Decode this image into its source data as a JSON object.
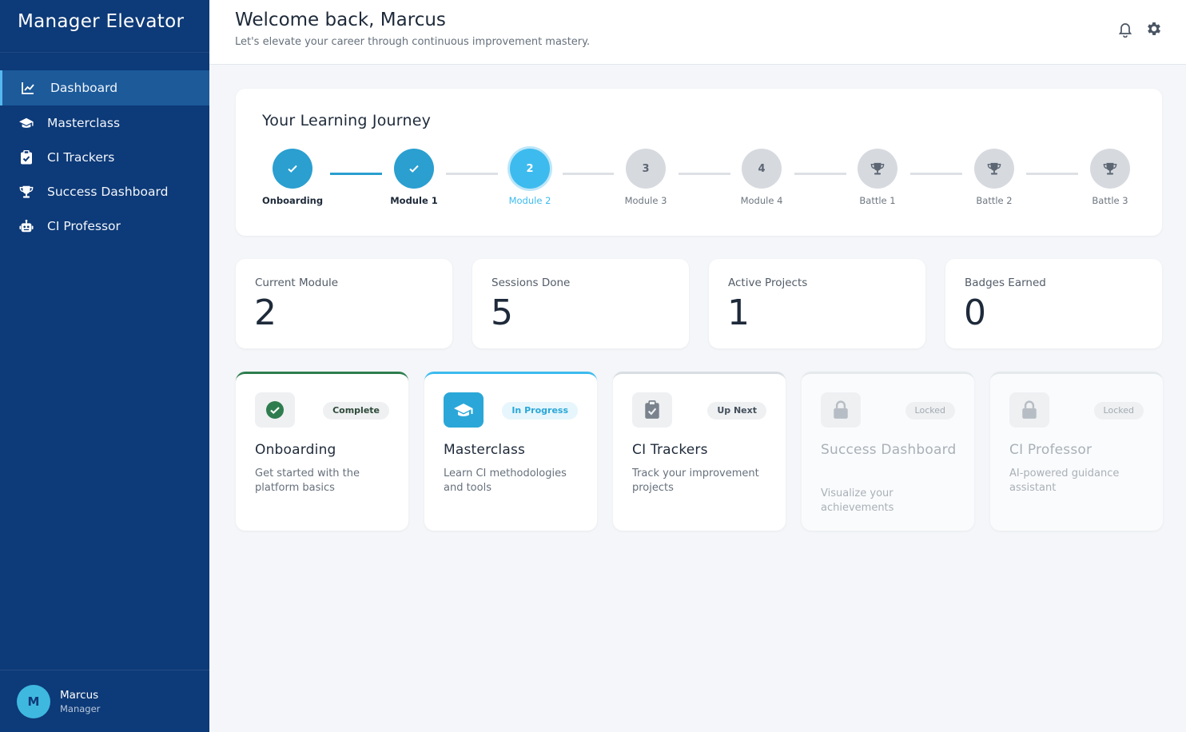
{
  "app": {
    "title": "Manager Elevator"
  },
  "sidebar": {
    "items": [
      {
        "label": "Dashboard",
        "icon": "chart-line-icon"
      },
      {
        "label": "Masterclass",
        "icon": "graduation-cap-icon"
      },
      {
        "label": "CI Trackers",
        "icon": "clipboard-check-icon"
      },
      {
        "label": "Success Dashboard",
        "icon": "trophy-icon"
      },
      {
        "label": "CI Professor",
        "icon": "robot-icon"
      }
    ],
    "active": "Dashboard"
  },
  "user": {
    "initial": "M",
    "name": "Marcus",
    "role": "Manager"
  },
  "header": {
    "welcome": "Welcome back, Marcus",
    "subtitle": "Let's elevate your career through continuous improvement mastery.",
    "icons": [
      "bell-icon",
      "gear-icon"
    ]
  },
  "journey": {
    "title": "Your Learning Journey",
    "steps": [
      {
        "label": "Onboarding",
        "marker": "",
        "state": "done"
      },
      {
        "label": "Module 1",
        "marker": "",
        "state": "done"
      },
      {
        "label": "Module 2",
        "marker": "2",
        "state": "current"
      },
      {
        "label": "Module 3",
        "marker": "3",
        "state": "todo"
      },
      {
        "label": "Module 4",
        "marker": "4",
        "state": "todo"
      },
      {
        "label": "Battle 1",
        "marker": "",
        "state": "todo"
      },
      {
        "label": "Battle 2",
        "marker": "",
        "state": "todo"
      },
      {
        "label": "Battle 3",
        "marker": "",
        "state": "todo"
      }
    ]
  },
  "stats": [
    {
      "label": "Current Module",
      "value": "2"
    },
    {
      "label": "Sessions Done",
      "value": "5"
    },
    {
      "label": "Active Projects",
      "value": "1"
    },
    {
      "label": "Badges Earned",
      "value": "0"
    }
  ],
  "modules": [
    {
      "title": "Onboarding",
      "description": "Get started with the platform basics",
      "status": "Complete",
      "icon": "check-circle-icon"
    },
    {
      "title": "Masterclass",
      "description": "Learn CI methodologies and tools",
      "status": "In Progress",
      "icon": "graduation-cap-icon"
    },
    {
      "title": "CI Trackers",
      "description": "Track your improvement projects",
      "status": "Up Next",
      "icon": "clipboard-check-icon"
    },
    {
      "title": "Success Dashboard",
      "description": "Visualize your achievements",
      "status": "Locked",
      "icon": "lock-icon"
    },
    {
      "title": "CI Professor",
      "description": "AI-powered guidance assistant",
      "status": "Locked",
      "icon": "lock-icon"
    }
  ],
  "colors": {
    "sidebar": "#0d3a78",
    "accent": "#3dbbee",
    "complete": "#2e7d4f"
  }
}
